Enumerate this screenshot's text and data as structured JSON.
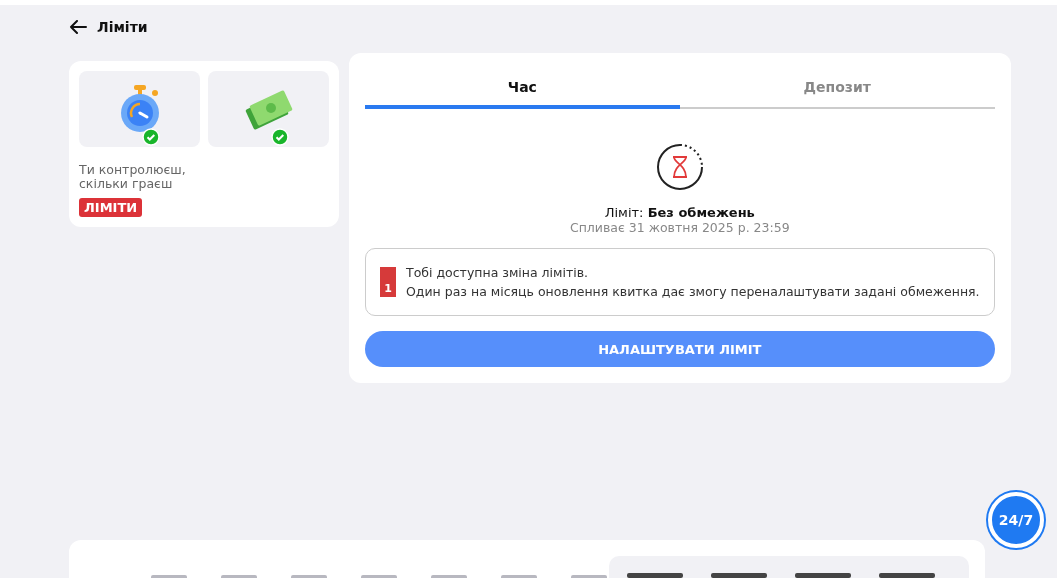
{
  "header": {
    "title": "Ліміти"
  },
  "promo": {
    "items": [
      {
        "kind": "stopwatch",
        "checked": true
      },
      {
        "kind": "cash",
        "checked": true
      }
    ],
    "text": "Ти контролюєш, скільки граєш",
    "badge": "ЛІМІТИ"
  },
  "tabs": [
    {
      "label": "Час",
      "selected": true
    },
    {
      "label": "Депозит",
      "selected": false
    }
  ],
  "limit": {
    "value": "Ліміт: **Без обмежень**",
    "expires": "Спливає 31 жовтня 2025 р. 23:59"
  },
  "notice": {
    "ticket": "1",
    "title": "Тобі доступна зміна лімітів.",
    "body": "Один раз на місяць оновлення квитка дає змогу переналаштувати задані обмеження."
  },
  "button": "НАЛАШТУВАТИ ЛІМІТ",
  "chat": {
    "label": "24/7"
  }
}
